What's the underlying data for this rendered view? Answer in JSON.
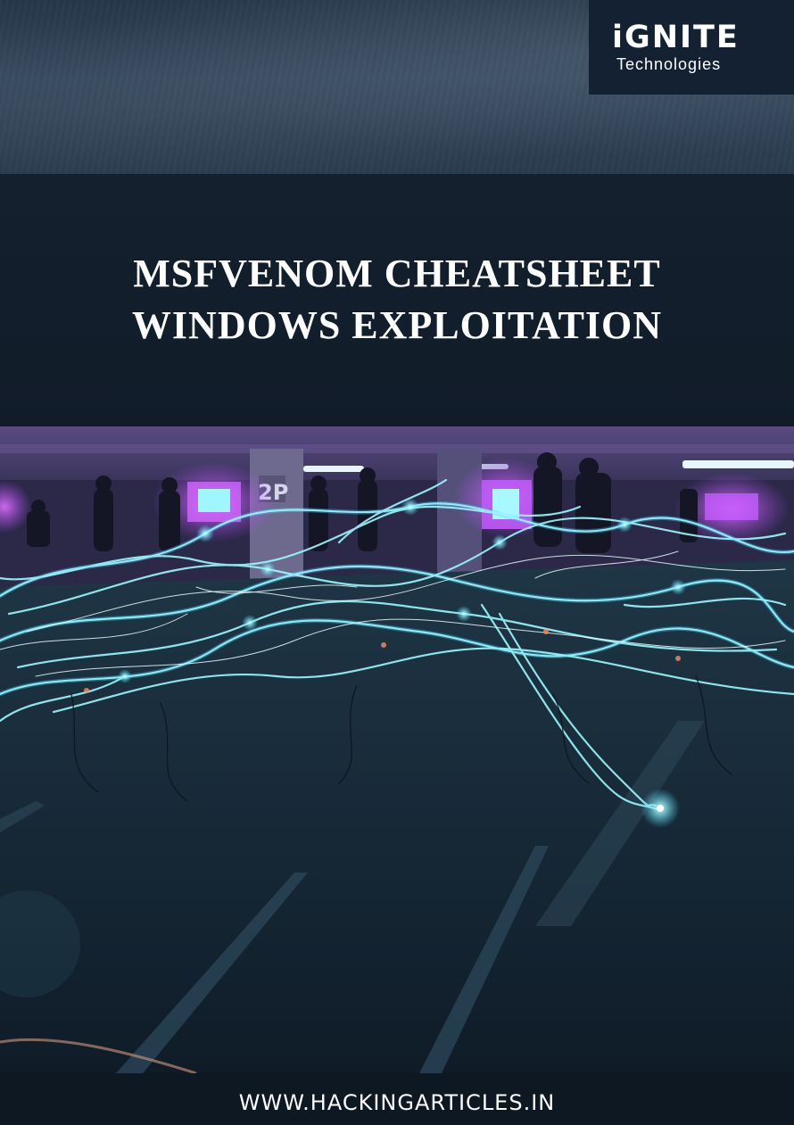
{
  "logo": {
    "name": "iGNITE",
    "tagline": "Technologies"
  },
  "title": {
    "line1": "MSFVENOM CHEATSHEET",
    "line2": "WINDOWS EXPLOITATION"
  },
  "photo": {
    "sign": "2P"
  },
  "footer": {
    "url": "WWW.HACKINGARTICLES.IN"
  },
  "colors": {
    "background": "#0e1a26",
    "title_band": "#14202e",
    "logo_box": "#132132",
    "fiber_glow": "#7ff0ff",
    "light_purple": "#b44cff",
    "text": "#ffffff"
  }
}
